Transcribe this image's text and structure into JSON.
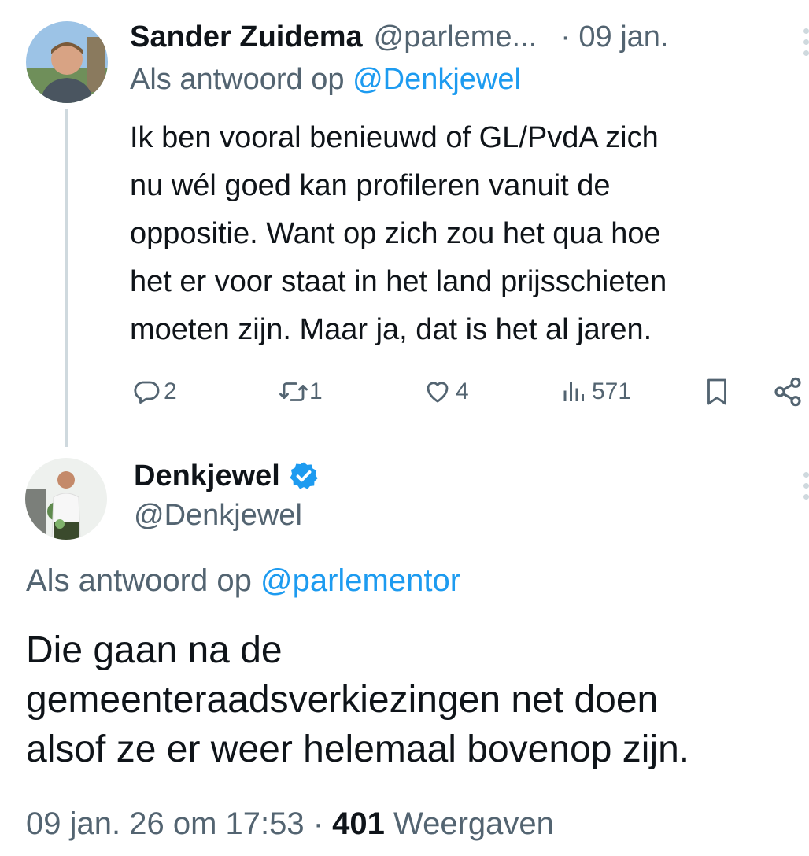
{
  "reply_tweet": {
    "display_name": "Sander Zuidema",
    "handle": "@parleme...",
    "time": "· 09 jan.",
    "reply_prefix": "Als antwoord op",
    "reply_to": "@Denkjewel",
    "text_lines": [
      "Ik ben vooral benieuwd of GL/PvdA zich",
      "nu wél goed kan profileren vanuit de",
      "oppositie. Want op zich zou het qua hoe",
      "het er voor staat in het land prijsschieten",
      "moeten zijn. Maar ja, dat is het al jaren."
    ],
    "actions": {
      "replies": "2",
      "reposts": "1",
      "likes": "4",
      "views": "571"
    }
  },
  "main_tweet": {
    "display_name": "Denkjewel",
    "handle": "@Denkjewel",
    "verified": true,
    "reply_prefix": "Als antwoord op",
    "reply_to": "@parlementor",
    "text_lines": [
      "Die gaan na de",
      "gemeenteraadsverkiezingen net doen",
      "alsof ze er weer helemaal bovenop zijn."
    ],
    "timestamp": "09 jan. 26 om 17:53",
    "separator": "·",
    "views_count": "401",
    "views_label": "Weergaven"
  },
  "colors": {
    "accent": "#1d9bf0",
    "muted": "#536471",
    "text": "#0f1419",
    "thread_line": "#cfd9de"
  },
  "icons": [
    "reply-icon",
    "repost-icon",
    "like-icon",
    "views-icon",
    "bookmark-icon",
    "share-icon",
    "verified-badge-icon",
    "more-icon"
  ]
}
